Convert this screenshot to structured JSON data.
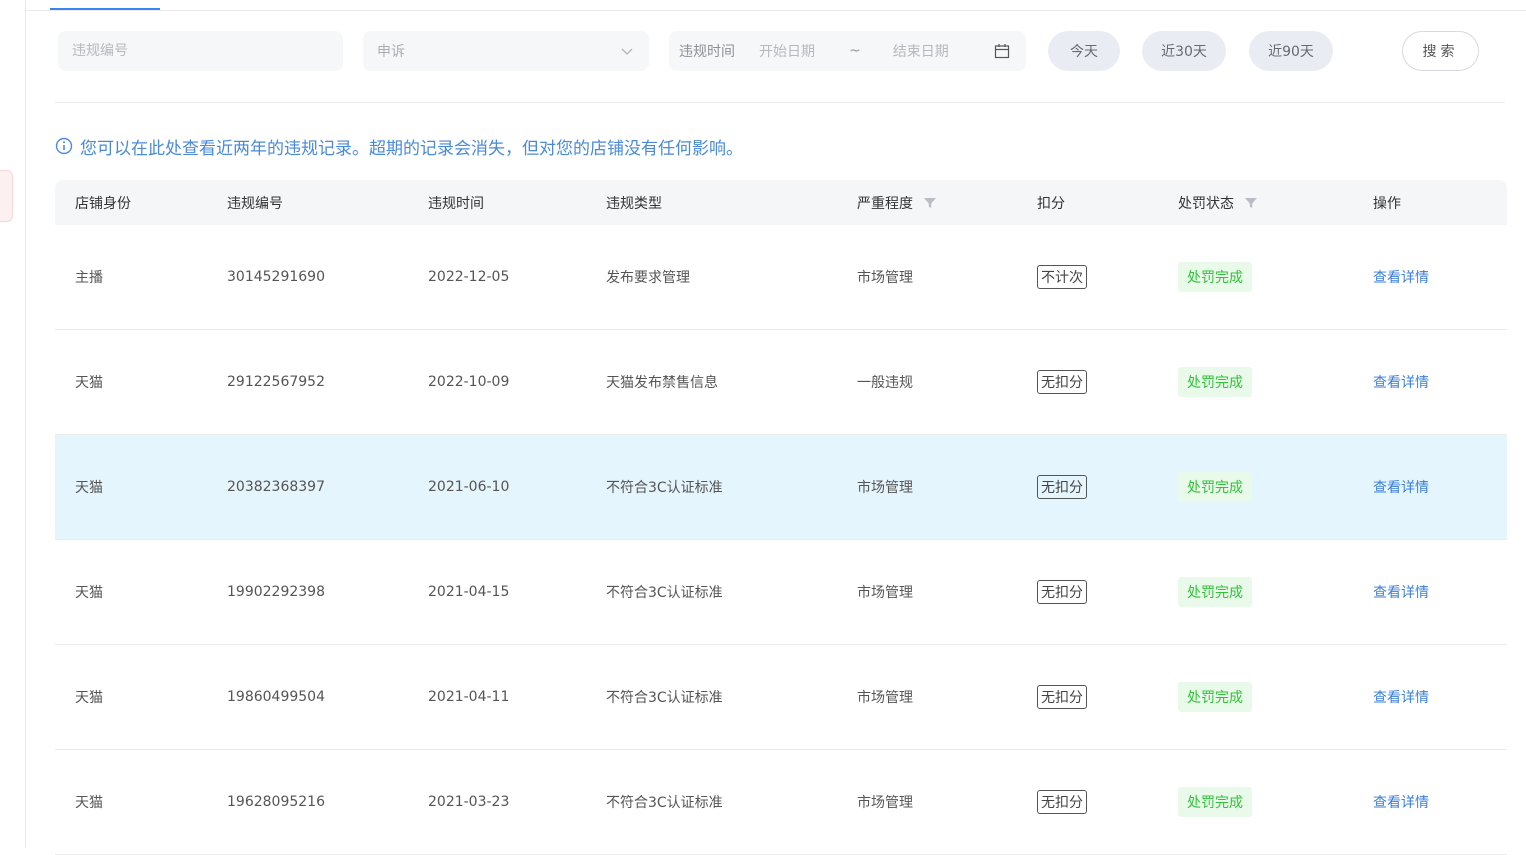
{
  "filters": {
    "violation_number_placeholder": "违规编号",
    "type_select_value": "申诉",
    "date_label": "违规时间",
    "start_placeholder": "开始日期",
    "separator": "~",
    "end_placeholder": "结束日期",
    "quick_today": "今天",
    "quick_30": "近30天",
    "quick_90": "近90天",
    "search_label": "搜索"
  },
  "notice": "您可以在此处查看近两年的违规记录。超期的记录会消失，但对您的店铺没有任何影响。",
  "table": {
    "headers": {
      "identity": "店铺身份",
      "number": "违规编号",
      "time": "违规时间",
      "type": "违规类型",
      "severity": "严重程度",
      "score": "扣分",
      "status": "处罚状态",
      "action": "操作"
    },
    "rows": [
      {
        "identity": "主播",
        "number": "30145291690",
        "time": "2022-12-05",
        "type": "发布要求管理",
        "severity": "市场管理",
        "score": "不计次",
        "status": "处罚完成",
        "action": "查看详情"
      },
      {
        "identity": "天猫",
        "number": "29122567952",
        "time": "2022-10-09",
        "type": "天猫发布禁售信息",
        "severity": "一般违规",
        "score": "无扣分",
        "status": "处罚完成",
        "action": "查看详情"
      },
      {
        "identity": "天猫",
        "number": "20382368397",
        "time": "2021-06-10",
        "type": "不符合3C认证标准",
        "severity": "市场管理",
        "score": "无扣分",
        "status": "处罚完成",
        "action": "查看详情"
      },
      {
        "identity": "天猫",
        "number": "19902292398",
        "time": "2021-04-15",
        "type": "不符合3C认证标准",
        "severity": "市场管理",
        "score": "无扣分",
        "status": "处罚完成",
        "action": "查看详情"
      },
      {
        "identity": "天猫",
        "number": "19860499504",
        "time": "2021-04-11",
        "type": "不符合3C认证标准",
        "severity": "市场管理",
        "score": "无扣分",
        "status": "处罚完成",
        "action": "查看详情"
      },
      {
        "identity": "天猫",
        "number": "19628095216",
        "time": "2021-03-23",
        "type": "不符合3C认证标准",
        "severity": "市场管理",
        "score": "无扣分",
        "status": "处罚完成",
        "action": "查看详情"
      }
    ]
  },
  "colors": {
    "accent": "#3b82f6",
    "link": "#3b7fd9",
    "status_text": "#32c13a",
    "status_bg": "#eafaea",
    "highlight_row": "#e5f5fd"
  }
}
